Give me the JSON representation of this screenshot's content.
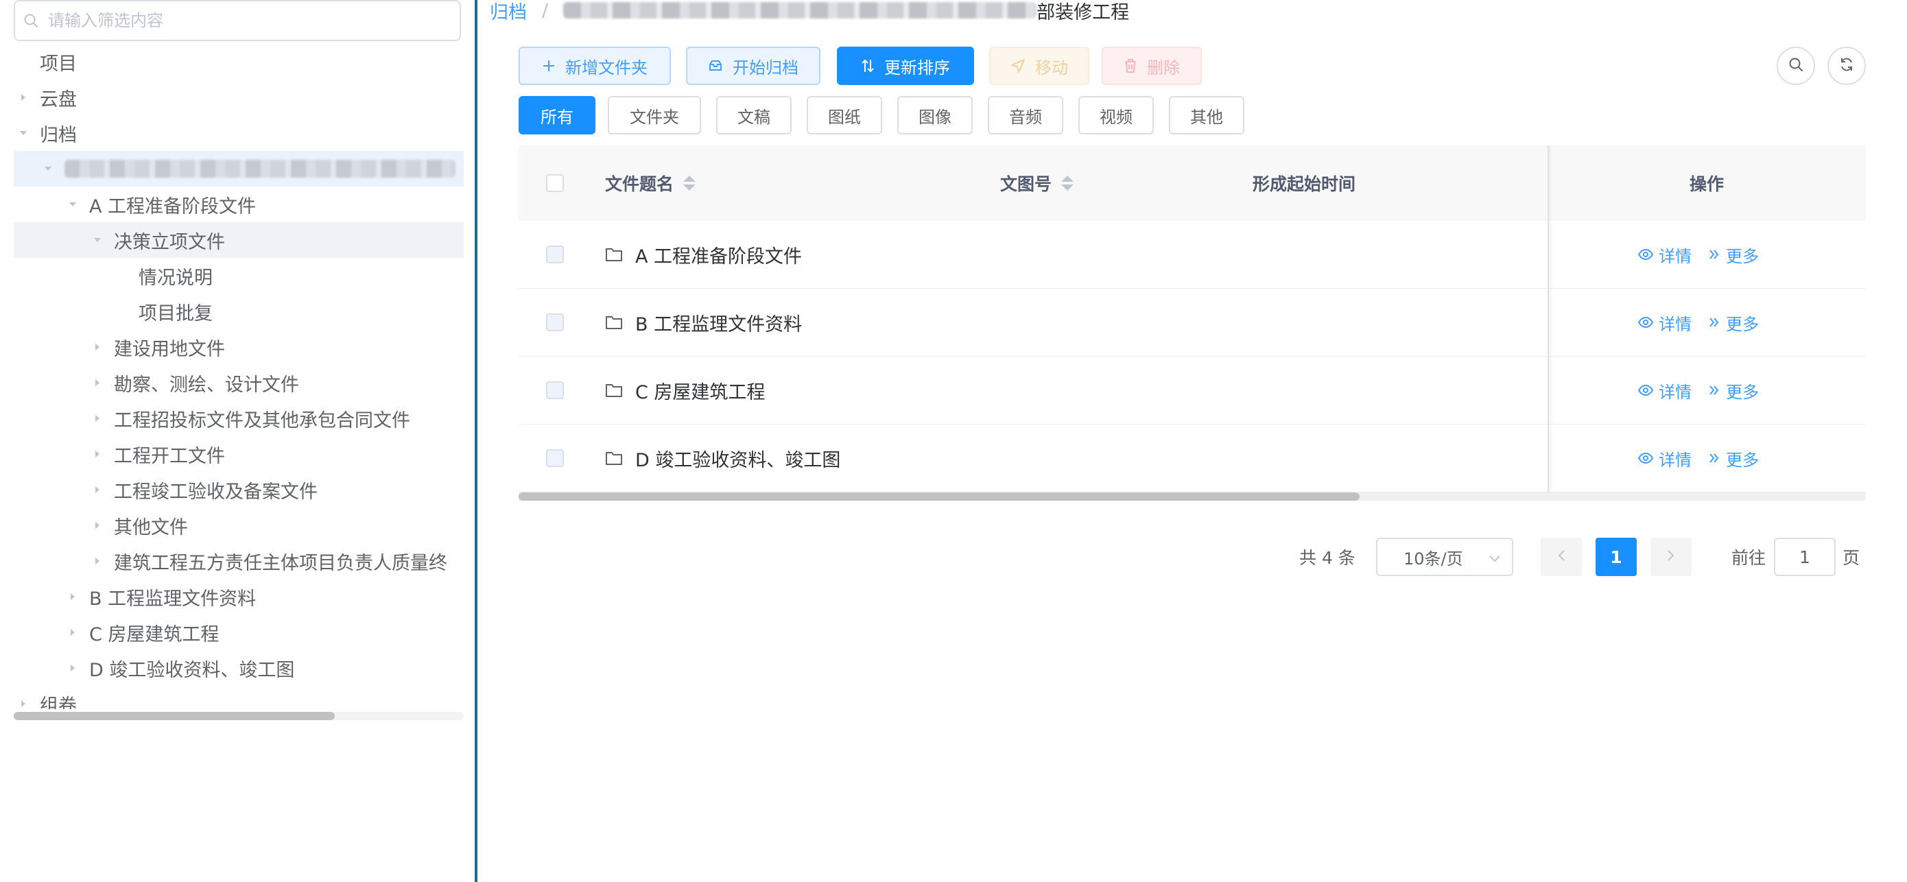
{
  "sidebar": {
    "search_placeholder": "请输入筛选内容",
    "tree": [
      {
        "label": "项目",
        "level": 0,
        "caret": "none"
      },
      {
        "label": "云盘",
        "level": 0,
        "caret": "collapsed"
      },
      {
        "label": "归档",
        "level": 0,
        "caret": "expanded"
      },
      {
        "label": "",
        "level": 1,
        "caret": "expanded",
        "blurred": true
      },
      {
        "label": "A 工程准备阶段文件",
        "level": 2,
        "caret": "expanded"
      },
      {
        "label": "决策立项文件",
        "level": 3,
        "caret": "expanded",
        "current": true
      },
      {
        "label": "情况说明",
        "level": 4,
        "caret": "none"
      },
      {
        "label": "项目批复",
        "level": 4,
        "caret": "none"
      },
      {
        "label": "建设用地文件",
        "level": 3,
        "caret": "collapsed"
      },
      {
        "label": "勘察、测绘、设计文件",
        "level": 3,
        "caret": "collapsed"
      },
      {
        "label": "工程招投标文件及其他承包合同文件",
        "level": 3,
        "caret": "collapsed"
      },
      {
        "label": "工程开工文件",
        "level": 3,
        "caret": "collapsed"
      },
      {
        "label": "工程竣工验收及备案文件",
        "level": 3,
        "caret": "collapsed"
      },
      {
        "label": "其他文件",
        "level": 3,
        "caret": "collapsed"
      },
      {
        "label": "建筑工程五方责任主体项目负责人质量终",
        "level": 3,
        "caret": "collapsed"
      },
      {
        "label": "B 工程监理文件资料",
        "level": 2,
        "caret": "collapsed"
      },
      {
        "label": "C 房屋建筑工程",
        "level": 2,
        "caret": "collapsed"
      },
      {
        "label": "D 竣工验收资料、竣工图",
        "level": 2,
        "caret": "collapsed"
      },
      {
        "label": "组卷",
        "level": 0,
        "caret": "collapsed"
      }
    ]
  },
  "breadcrumb": {
    "root": "归档",
    "separator": "/",
    "tail": "部装修工程"
  },
  "toolbar": {
    "add_folder": "新增文件夹",
    "start_archive": "开始归档",
    "update_sort": "更新排序",
    "move": "移动",
    "delete": "删除"
  },
  "filters": [
    "所有",
    "文件夹",
    "文稿",
    "图纸",
    "图像",
    "音频",
    "视频",
    "其他"
  ],
  "active_filter": "所有",
  "table": {
    "columns": {
      "title": "文件题名",
      "doc_no": "文图号",
      "start_time": "形成起始时间",
      "actions": "操作"
    },
    "rows": [
      {
        "title": "A 工程准备阶段文件"
      },
      {
        "title": "B 工程监理文件资料"
      },
      {
        "title": "C 房屋建筑工程"
      },
      {
        "title": "D 竣工验收资料、竣工图"
      }
    ],
    "action_detail": "详情",
    "action_more": "更多"
  },
  "pagination": {
    "total_text": "共 4 条",
    "page_size": "10条/页",
    "current_page": "1",
    "goto_label": "前往",
    "goto_value": "1",
    "page_suffix": "页"
  },
  "colors": {
    "primary": "#1890ff",
    "link": "#409eff",
    "divider": "#1d6e8c"
  }
}
